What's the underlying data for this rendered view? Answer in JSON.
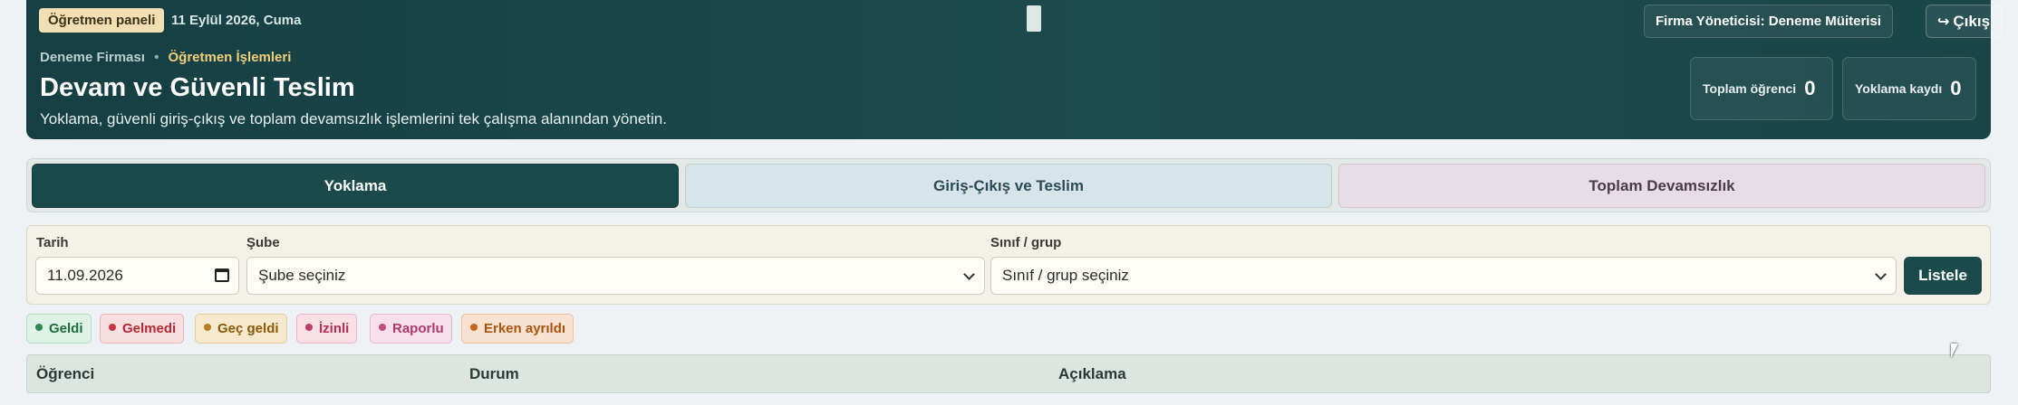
{
  "header": {
    "panel_badge": "Öğretmen paneli",
    "date": "11 Eylül 2026, Cuma",
    "user_chip": "Firma Yöneticisi: Deneme Müiterisi",
    "logout_label": "Çıkış",
    "logout_icon": "sign-out-arrow-icon",
    "breadcrumb": {
      "company": "Deneme Firması",
      "separator": "•",
      "section": "Öğretmen İşlemleri"
    },
    "title": "Devam ve Güvenli Teslim",
    "description": "Yoklama, güvenli giriş-çıkış ve toplam devamsızlık işlemlerini tek çalışma alanından yönetin.",
    "stats": [
      {
        "label": "Toplam öğrenci",
        "value": "0"
      },
      {
        "label": "Yoklama kaydı",
        "value": "0"
      }
    ],
    "colors": {
      "header_bg": "#1c4b4d",
      "accent_gold": "#f0cf7a"
    }
  },
  "tabs": [
    {
      "label": "Yoklama",
      "active": true
    },
    {
      "label": "Giriş-Çıkış ve Teslim",
      "active": false
    },
    {
      "label": "Toplam Devamsızlık",
      "active": false
    }
  ],
  "filters": {
    "date": {
      "label": "Tarih",
      "value": "11.09.2026"
    },
    "branch": {
      "label": "Şube",
      "value": "Şube seçiniz"
    },
    "group": {
      "label": "Sınıf / grup",
      "value": "Sınıf / grup seçiniz"
    },
    "submit_label": "Listele"
  },
  "legend": [
    {
      "label": "Geldi",
      "color": "#2f8a51"
    },
    {
      "label": "Gelmedi",
      "color": "#c7363f"
    },
    {
      "label": "Geç geldi",
      "color": "#b47d1a"
    },
    {
      "label": "İzinli",
      "color": "#c23e6a"
    },
    {
      "label": "Raporlu",
      "color": "#c24d7f"
    },
    {
      "label": "Erken ayrıldı",
      "color": "#c4661f"
    }
  ],
  "table": {
    "columns": [
      "Öğrenci",
      "Durum",
      "Açıklama"
    ]
  }
}
